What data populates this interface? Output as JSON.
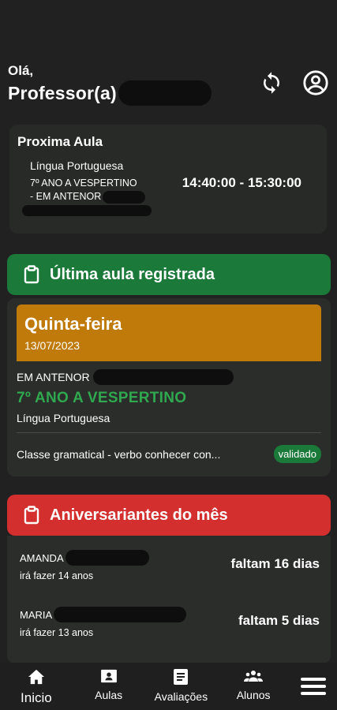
{
  "header": {
    "greeting": "Olá,",
    "title": "Professor(a)",
    "icons": [
      "sync-icon",
      "account-circle-icon"
    ]
  },
  "next_lesson": {
    "title": "Proxima Aula",
    "subject": "Língua Portuguesa",
    "class_line1": "7º ANO A VESPERTINO",
    "class_line2": "- EM ANTENOR",
    "time": "14:40:00 - 15:30:00"
  },
  "last_lesson": {
    "section_title": "Última aula registrada",
    "weekday": "Quinta-feira",
    "date": "13/07/2023",
    "school": "EM ANTENOR",
    "class": "7º ANO A VESPERTINO",
    "subject": "Língua Portuguesa",
    "topic": "Classe gramatical - verbo conhecer con...",
    "status": "validado"
  },
  "birthdays": {
    "section_title": "Aniversariantes do mês",
    "items": [
      {
        "name": "AMANDA",
        "age": "irá fazer 14 anos",
        "remaining": "faltam 16 dias"
      },
      {
        "name": "MARIA",
        "age": "irá fazer 13 anos",
        "remaining": "faltam 5 dias"
      }
    ]
  },
  "nav": {
    "items": [
      {
        "label": "Inicio",
        "icon": "home-icon"
      },
      {
        "label": "Aulas",
        "icon": "class-icon"
      },
      {
        "label": "Avaliações",
        "icon": "assessment-icon"
      },
      {
        "label": "Alunos",
        "icon": "students-icon"
      }
    ],
    "menu_icon": "menu-icon"
  },
  "colors": {
    "background": "#212121",
    "green": "#1b7a3a",
    "green_text": "#2fa84f",
    "orange": "#c07a09",
    "red": "#d32f2f"
  }
}
